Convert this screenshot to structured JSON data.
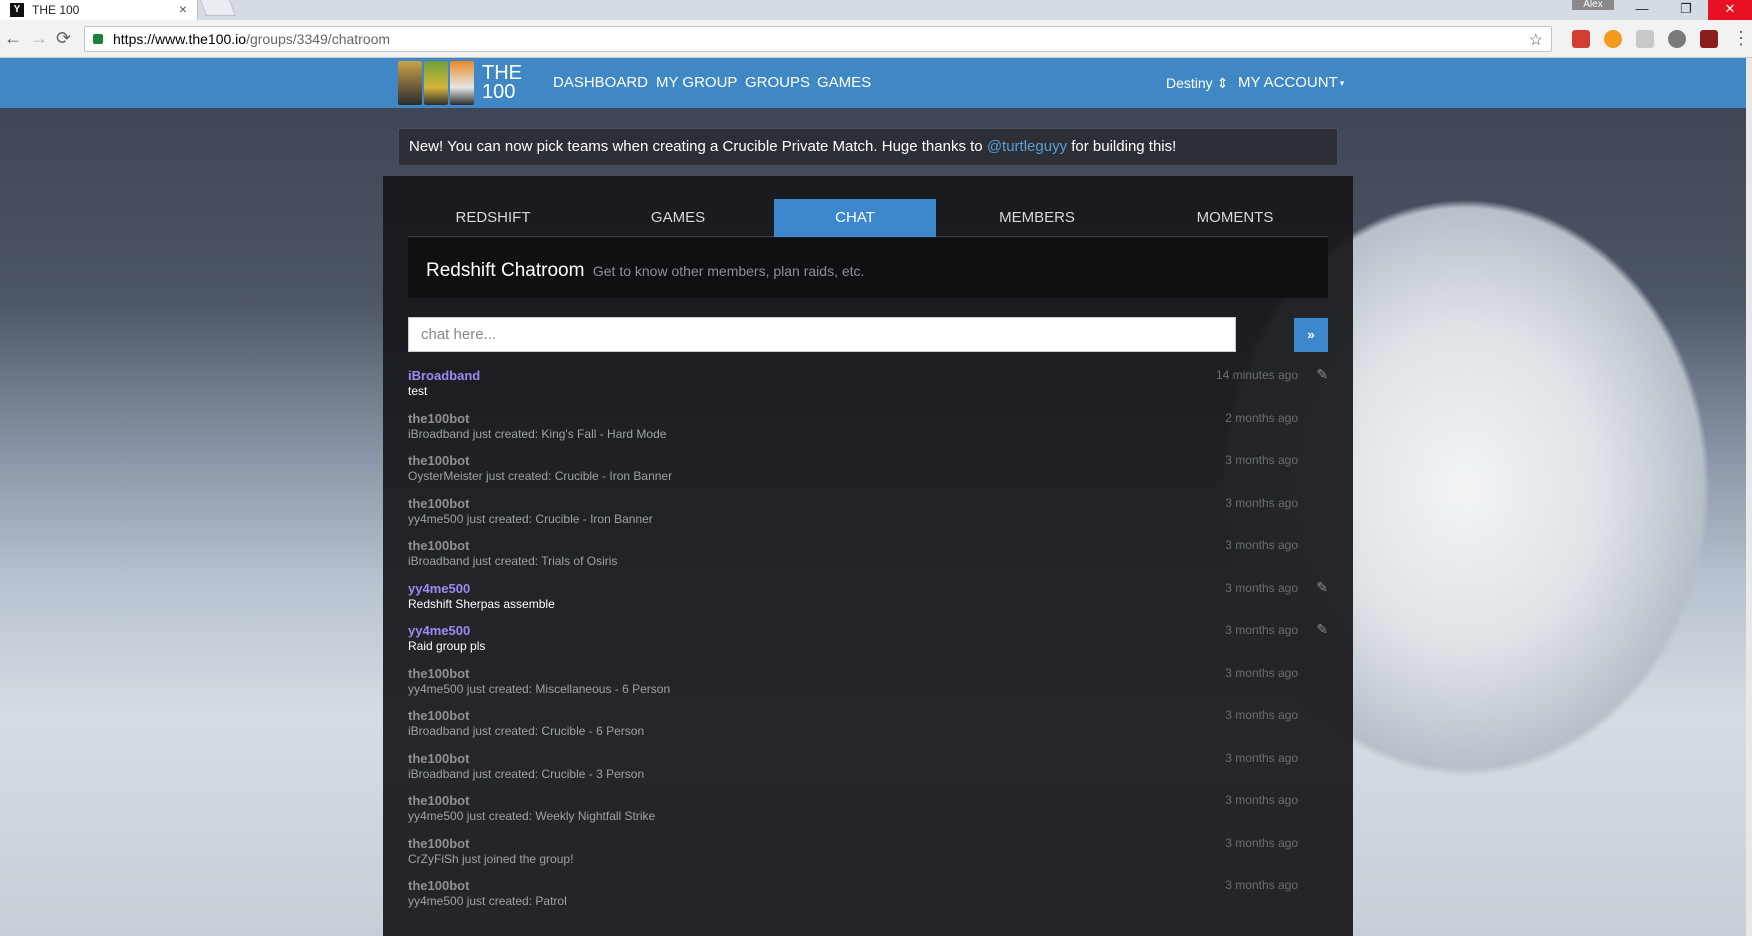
{
  "browser": {
    "tab_title": "THE 100",
    "tab_close": "×",
    "profile_name": "Alex",
    "url_host": "https://www.the100.io",
    "url_path": "/groups/3349/chatroom",
    "back": "←",
    "forward": "→",
    "reload": "⟳",
    "star": "☆",
    "minimize": "—",
    "restore": "❐",
    "close": "✕",
    "menu": "⋮"
  },
  "site": {
    "logo_text_top": "THE",
    "logo_text_bottom": "100",
    "nav": [
      "DASHBOARD",
      "MY GROUP",
      "GROUPS",
      "GAMES"
    ],
    "game_selector": "Destiny ⇕",
    "account": "MY ACCOUNT",
    "account_caret": "▾"
  },
  "announcement": {
    "text_before": "New! You can now pick teams when creating a Crucible Private Match. Huge thanks to ",
    "link": "@turtleguyy",
    "text_after": " for building this!"
  },
  "group_tabs": [
    "REDSHIFT",
    "GAMES",
    "CHAT",
    "MEMBERS",
    "MOMENTS"
  ],
  "chatroom": {
    "title": "Redshift Chatroom",
    "subtitle": "Get to know other members, plan raids, etc.",
    "input_placeholder": "chat here...",
    "send_label": "»"
  },
  "messages": [
    {
      "author": "iBroadband",
      "text": "test",
      "time": "14 minutes ago",
      "user": true,
      "editable": true
    },
    {
      "author": "the100bot",
      "text": "iBroadband just created: King's Fall - Hard Mode",
      "time": "2 months ago",
      "user": false,
      "editable": false
    },
    {
      "author": "the100bot",
      "text": "OysterMeister just created: Crucible - Iron Banner",
      "time": "3 months ago",
      "user": false,
      "editable": false
    },
    {
      "author": "the100bot",
      "text": "yy4me500 just created: Crucible - Iron Banner",
      "time": "3 months ago",
      "user": false,
      "editable": false
    },
    {
      "author": "the100bot",
      "text": "iBroadband just created: Trials of Osiris",
      "time": "3 months ago",
      "user": false,
      "editable": false
    },
    {
      "author": "yy4me500",
      "text": "Redshift Sherpas assemble",
      "time": "3 months ago",
      "user": true,
      "editable": true
    },
    {
      "author": "yy4me500",
      "text": "Raid group pls",
      "time": "3 months ago",
      "user": true,
      "editable": true
    },
    {
      "author": "the100bot",
      "text": "yy4me500 just created: Miscellaneous - 6 Person",
      "time": "3 months ago",
      "user": false,
      "editable": false
    },
    {
      "author": "the100bot",
      "text": "iBroadband just created: Crucible - 6 Person",
      "time": "3 months ago",
      "user": false,
      "editable": false
    },
    {
      "author": "the100bot",
      "text": "iBroadband just created: Crucible - 3 Person",
      "time": "3 months ago",
      "user": false,
      "editable": false
    },
    {
      "author": "the100bot",
      "text": "yy4me500 just created: Weekly Nightfall Strike",
      "time": "3 months ago",
      "user": false,
      "editable": false
    },
    {
      "author": "the100bot",
      "text": "CrZyFiSh just joined the group!",
      "time": "3 months ago",
      "user": false,
      "editable": false
    },
    {
      "author": "the100bot",
      "text": "yy4me500 just created: Patrol",
      "time": "3 months ago",
      "user": false,
      "editable": false
    }
  ],
  "icons": {
    "edit": "pencil-icon",
    "lock": "lock-icon",
    "favicon": "destiny-favicon-icon"
  },
  "colors": {
    "site_bar": "#3f88c5",
    "active_tab": "#3d88cc",
    "user_name": "#9b8cf0",
    "link": "#5a9fd8"
  }
}
